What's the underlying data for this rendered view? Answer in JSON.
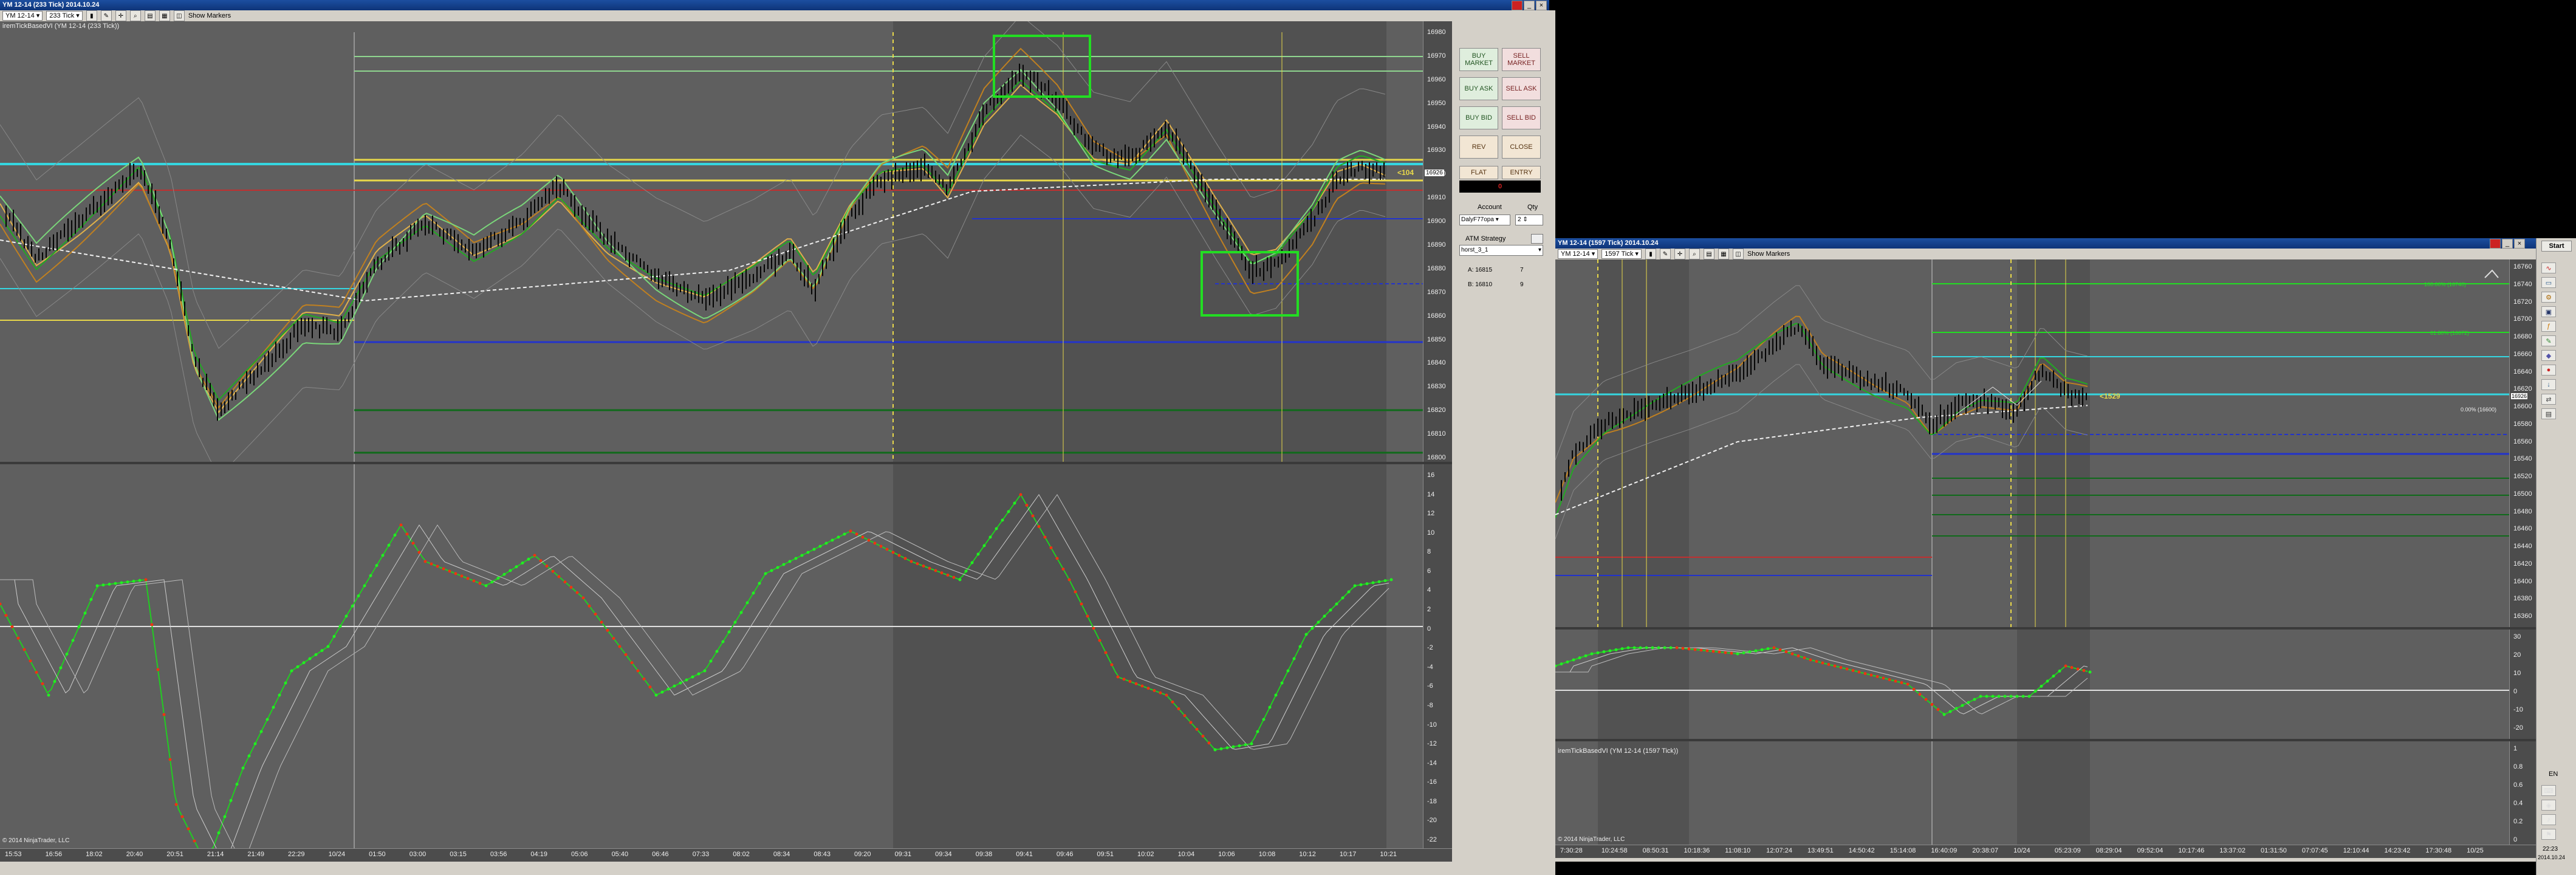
{
  "main_window": {
    "title": "YM 12-14 (233 Tick)  2014.10.24",
    "instrument": "YM 12-14",
    "interval": "233 Tick",
    "show_markers_label": "Show Markers",
    "indicator_label": "iremTickBasedVI (YM 12-14 (233 Tick))",
    "copyright": "© 2014 NinjaTrader, LLC",
    "price_ticks": [
      "16980",
      "16970",
      "16960",
      "16950",
      "16940",
      "16930",
      "16920",
      "16910",
      "16900",
      "16890",
      "16880",
      "16870",
      "16860",
      "16850",
      "16840",
      "16830",
      "16820",
      "16810",
      "16800"
    ],
    "current_price": "16926",
    "price_marker": "<104",
    "osc_ticks": [
      "16",
      "14",
      "12",
      "10",
      "8",
      "6",
      "4",
      "2",
      "0",
      "-2",
      "-4",
      "-6",
      "-8",
      "-10",
      "-12",
      "-14",
      "-16",
      "-18",
      "-20",
      "-22"
    ],
    "time_ticks": [
      "15:53",
      "16:56",
      "18:02",
      "20:40",
      "20:51",
      "21:14",
      "21:49",
      "22:29",
      "10/24",
      "01:50",
      "03:00",
      "03:15",
      "03:56",
      "04:19",
      "05:06",
      "05:40",
      "06:46",
      "07:33",
      "08:02",
      "08:34",
      "08:43",
      "09:20",
      "09:31",
      "09:34",
      "09:38",
      "09:41",
      "09:46",
      "09:51",
      "10:02",
      "10:04",
      "10:06",
      "10:08",
      "10:12",
      "10:17",
      "10:21"
    ]
  },
  "order_panel": {
    "buttons": [
      {
        "label": "BUY MARKET",
        "kind": "buy"
      },
      {
        "label": "SELL MARKET",
        "kind": "sell"
      },
      {
        "label": "BUY ASK",
        "kind": "buy"
      },
      {
        "label": "SELL ASK",
        "kind": "sell"
      },
      {
        "label": "BUY BID",
        "kind": "buy"
      },
      {
        "label": "SELL BID",
        "kind": "sell"
      },
      {
        "label": "REV",
        "kind": "neutral"
      },
      {
        "label": "CLOSE",
        "kind": "neutral"
      }
    ],
    "flat_label": "FLAT",
    "entry_label": "ENTRY",
    "position_value": "0",
    "account_label": "Account",
    "qty_label": "Qty",
    "account_value": "DalyF77opa",
    "qty_value": "2",
    "atm_label": "ATM Strategy",
    "atm_value": "horst_3_1",
    "ask_label": "A: 16815",
    "ask_size": "7",
    "bid_label": "B: 16810",
    "bid_size": "9"
  },
  "second_window": {
    "title": "YM 12-14 (1597 Tick)  2014.10.24",
    "instrument": "YM 12-14",
    "interval": "1597 Tick",
    "show_markers_label": "Show Markers",
    "indicator_label": "iremTickBasedVI (YM 12-14 (1597 Tick))",
    "copyright": "© 2014 NinjaTrader, LLC",
    "price_ticks": [
      "16760",
      "16740",
      "16720",
      "16700",
      "16680",
      "16660",
      "16640",
      "16620",
      "16600",
      "16580",
      "16560",
      "16540",
      "16520",
      "16500",
      "16480",
      "16460",
      "16440",
      "16420",
      "16400",
      "16380",
      "16360"
    ],
    "current_price": "16926",
    "price_marker": "<1529",
    "fib_labels": [
      "100.00% (16740)",
      "61.80% (16672)",
      "0.00% (16600)"
    ],
    "osc_ticks": [
      "30",
      "20",
      "10",
      "0",
      "-10",
      "-20"
    ],
    "osc2_ticks": [
      "1",
      "0.8",
      "0.6",
      "0.4",
      "0.2",
      "0"
    ],
    "time_ticks": [
      "7:30:28",
      "10:24:58",
      "08:50:31",
      "10:18:36",
      "11:08:10",
      "12:07:24",
      "13:49:51",
      "14:50:42",
      "15:14:08",
      "16:40:09",
      "20:38:07",
      "10/24",
      "05:23:09",
      "08:29:04",
      "09:52:04",
      "10:17:46",
      "13:37:02",
      "01:31:50",
      "07:07:45",
      "12:10:44",
      "14:23:42",
      "17:30:48",
      "10/25"
    ],
    "corner_date": "2014.10.24"
  },
  "sidebar": {
    "start_label": "Start",
    "lang": "EN",
    "clock": "22:23",
    "date": "2014.10.24"
  },
  "colors": {
    "chart_bg": "#5f5f5f",
    "chart_bg_dark": "#4d4d4d",
    "cyan": "#35d6e0",
    "yellow": "#e8d84a",
    "green_box": "#22dd22",
    "blue": "#2233cc",
    "dark_green": "#0f5a1a",
    "red": "#c03030"
  }
}
